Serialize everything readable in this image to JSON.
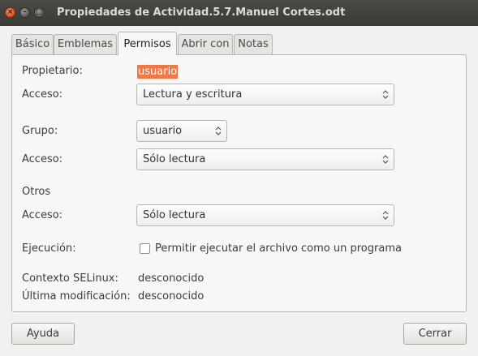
{
  "window": {
    "title": "Propiedades de Actividad.5.7.Manuel Cortes.odt"
  },
  "tabs": [
    {
      "label": "Básico"
    },
    {
      "label": "Emblemas"
    },
    {
      "label": "Permisos",
      "active": true
    },
    {
      "label": "Abrir con"
    },
    {
      "label": "Notas"
    }
  ],
  "permissions": {
    "owner_label": "Propietario:",
    "owner_value": "usuario",
    "owner_access_label": "Acceso:",
    "owner_access_value": "Lectura y escritura",
    "group_label": "Grupo:",
    "group_value": "usuario",
    "group_access_label": "Acceso:",
    "group_access_value": "Sólo lectura",
    "others_label": "Otros",
    "others_access_label": "Acceso:",
    "others_access_value": "Sólo lectura",
    "execution_label": "Ejecución:",
    "execution_checkbox_label": "Permitir ejecutar el archivo como un programa",
    "execution_checked": false,
    "selinux_label": "Contexto SELinux:",
    "selinux_value": "desconocido",
    "modified_label": "Última modificación:",
    "modified_value": "desconocido"
  },
  "buttons": {
    "help": "Ayuda",
    "close": "Cerrar"
  },
  "colors": {
    "titlebar": "#3c3b37",
    "close_button": "#e4561c",
    "selection": "#f07746",
    "background": "#f2f1f0"
  },
  "icons": {
    "close": "close-icon",
    "minimize": "minimize-icon",
    "maximize": "maximize-icon",
    "combo": "combo-arrows-icon"
  }
}
